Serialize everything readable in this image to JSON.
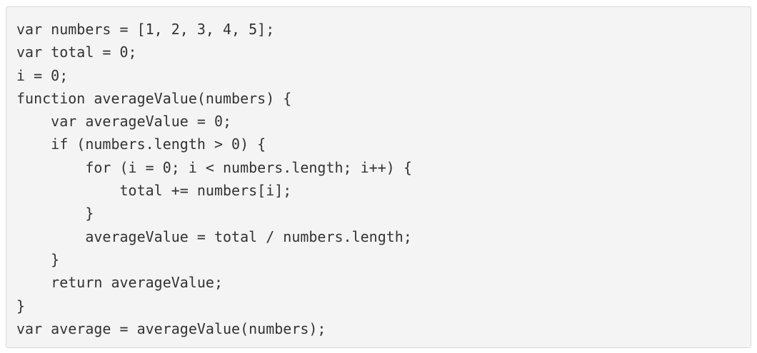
{
  "code_block": {
    "lines": [
      "var numbers = [1, 2, 3, 4, 5];",
      "var total = 0;",
      "i = 0;",
      "function averageValue(numbers) {",
      "    var averageValue = 0;",
      "    if (numbers.length > 0) {",
      "        for (i = 0; i < numbers.length; i++) {",
      "            total += numbers[i];",
      "        }",
      "        averageValue = total / numbers.length;",
      "    }",
      "    return averageValue;",
      "}",
      "var average = averageValue(numbers);"
    ]
  }
}
